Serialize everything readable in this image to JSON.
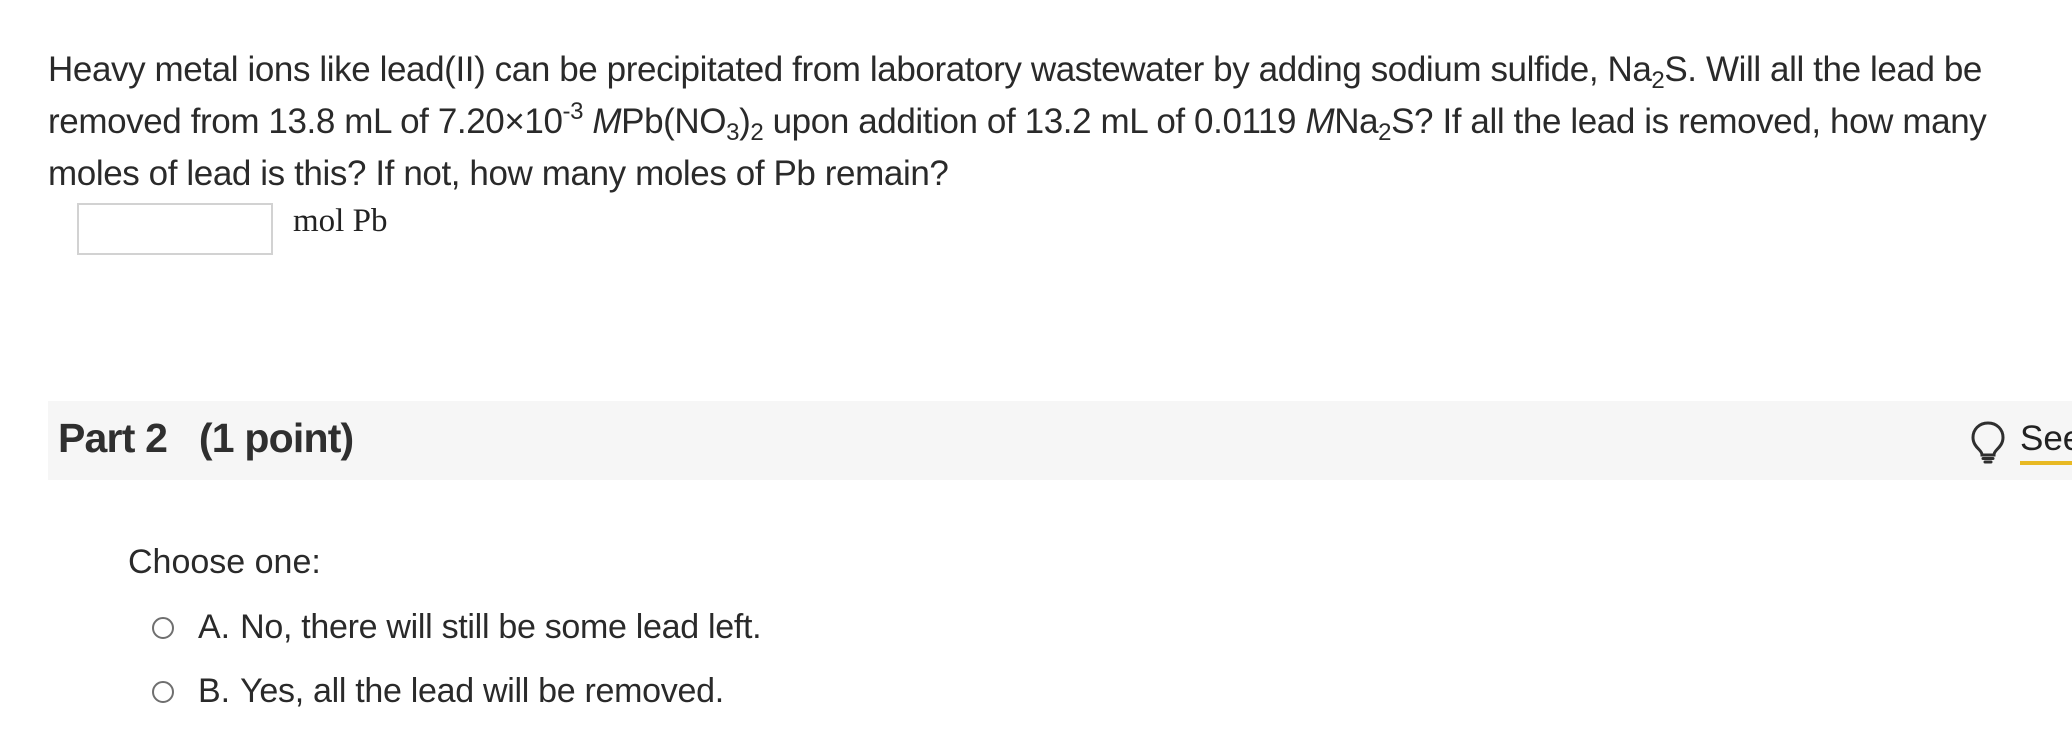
{
  "question": {
    "p1": "Heavy metal ions like lead(II) can be precipitated from laboratory wastewater by adding sodium sulfide, Na",
    "s1": "2",
    "p2": "S. Will all the lead be removed from 13.8 mL of 7.20×10",
    "sup1": "-3",
    "m1": "M",
    "p3": "Pb(NO",
    "s2": "3",
    "p4": ")",
    "s3": "2",
    "p5": " upon addition of 13.2 mL of 0.0119 ",
    "m2": "M",
    "p6": "Na",
    "s4": "2",
    "p7": "S? If all the lead is removed, how many moles of lead is this? If not, how many moles of Pb remain?"
  },
  "answer": {
    "value": "",
    "unit": "mol Pb"
  },
  "part2": {
    "title": "Part 2   (1 point)",
    "hint_label": "See",
    "hint_icon": "lightbulb-icon",
    "hint_underline_color": "#e8b923",
    "choose_label": "Choose one:",
    "options": [
      {
        "letter": "A.",
        "text": "No, there will still be some lead left."
      },
      {
        "letter": "B.",
        "text": "Yes, all the lead will be removed."
      }
    ]
  }
}
